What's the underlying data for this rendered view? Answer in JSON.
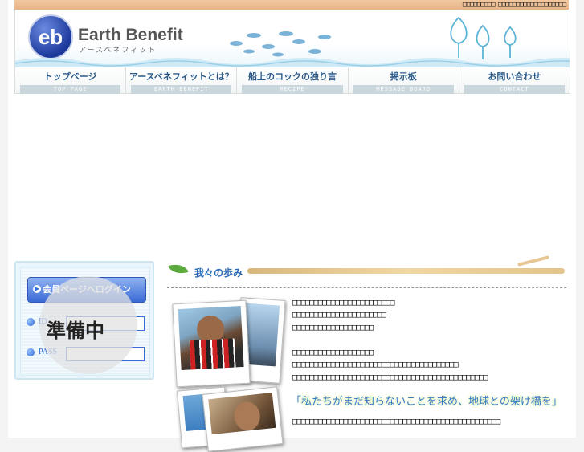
{
  "top_bar": {
    "text": "□□□□□□□□□ □□□□□□□□□□□□□□□□□□□"
  },
  "header": {
    "logo_mark": "eb",
    "logo_title": "Earth Benefit",
    "logo_subtitle": "アースベネフィット"
  },
  "nav": {
    "items": [
      {
        "label": "トップページ",
        "sub": "TOP PAGE"
      },
      {
        "label": "アースベネフィットとは？",
        "sub": "EARTH BENEFIT"
      },
      {
        "label": "船上のコックの独り言",
        "sub": "RECIPE"
      },
      {
        "label": "掲示板",
        "sub": "MESSAGE BOARD"
      },
      {
        "label": "お問い合わせ",
        "sub": "CONTACT"
      }
    ]
  },
  "login": {
    "button_label": "会員ページへログイン",
    "id_label": "ID",
    "pass_label": "PASS",
    "overlay_text": "準備中"
  },
  "section": {
    "title": "我々の歩み",
    "para_lines": [
      "□□□□□□□□□□□□□□□□□□□□□□□□",
      "□□□□□□□□□□□□□□□□□□□□□□",
      "□□□□□□□□□□□□□□□□□□□",
      "",
      "□□□□□□□□□□□□□□□□□□□",
      "□□□□□□□□□□□□□□□□□□□□□□□□□□□□□□□□□□□□□□□",
      "□□□□□□□□□□□□□□□□□□□□□□□□□□□□□□□□□□□□□□□□□□□□□□"
    ],
    "quote": "「私たちがまだ知らないことを求め、地球との架け橋を」",
    "para2": "□□□□□□□□□□□□□□□□□□□□□□□□□□□□□□□□□□□□□□□□□□□□□□□□□"
  },
  "colors": {
    "accent_blue": "#2a64d4",
    "nav_text": "#2a5a8a",
    "top_strip": "#e8b488"
  }
}
